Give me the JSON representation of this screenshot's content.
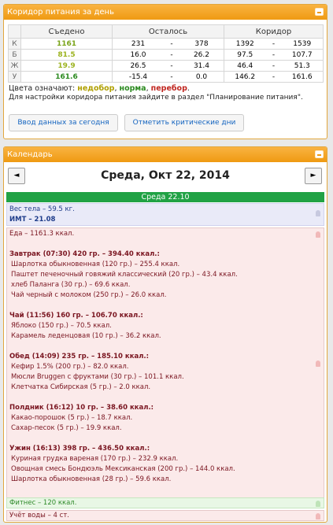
{
  "corridor_panel": {
    "title": "Коридор питания за день",
    "headers": [
      "Съедено",
      "Осталось",
      "Коридор"
    ],
    "rows": [
      {
        "label": "К",
        "eaten": "1161",
        "remain_min": "231",
        "remain_max": "378",
        "corr_min": "1392",
        "corr_max": "1539",
        "eaten_color": "#7aa41a"
      },
      {
        "label": "Б",
        "eaten": "81.5",
        "remain_min": "16.0",
        "remain_max": "26.2",
        "corr_min": "97.5",
        "corr_max": "107.7",
        "eaten_color": "#9cb31f"
      },
      {
        "label": "Ж",
        "eaten": "19.9",
        "remain_min": "26.5",
        "remain_max": "31.4",
        "corr_min": "46.4",
        "corr_max": "51.3",
        "eaten_color": "#9cb31f"
      },
      {
        "label": "У",
        "eaten": "161.6",
        "remain_min": "-15.4",
        "remain_max": "0.0",
        "corr_min": "146.2",
        "corr_max": "161.6",
        "eaten_color": "#2b8a1f"
      }
    ],
    "dash": "-",
    "legend": {
      "prefix": "Цвета означают:",
      "under": "недобор",
      "sep1": ",",
      "norm": "норма",
      "sep2": ",",
      "over": "перебор",
      "end": "."
    },
    "note": "Для настройки коридора питания зайдите в раздел \"Планирование питания\".",
    "btn_enter": "Ввод данных за сегодня",
    "btn_mark": "Отметить критические дни"
  },
  "calendar": {
    "title": "Календарь",
    "prev": "◄",
    "next": "►",
    "date_title": "Среда, Окт 22, 2014",
    "day_label": "Среда 22.10",
    "weight": "Вес тела – 59.5 кг.",
    "bmi": "ИМТ – 21.08",
    "food_total": "Еда – 1161.3 ккал.",
    "meals": [
      {
        "title": "Завтрак (07:30) 420 гр. – 394.40 ккал.:",
        "items": [
          "Шарлотка обыкновенная (120 гр.) – 255.4 ккал.",
          "Паштет печеночный говяжий классический (20 гр.) – 43.4 ккал.",
          "хлеб Паланга (30 гр.) – 69.6 ккал.",
          "Чай черный с молоком (250 гр.) – 26.0 ккал."
        ]
      },
      {
        "title": "Чай (11:56) 160 гр. – 106.70 ккал.:",
        "items": [
          "Яблоко (150 гр.) – 70.5 ккал.",
          "Карамель леденцовая (10 гр.) – 36.2 ккал."
        ]
      },
      {
        "title": "Обед (14:09) 235 гр. – 185.10 ккал.:",
        "items": [
          "Кефир 1.5% (200 гр.) – 82.0 ккал.",
          "Мюсли Bruggen с фруктами (30 гр.) – 101.1 ккал.",
          "Клетчатка Сибирская (5 гр.) – 2.0 ккал."
        ]
      },
      {
        "title": "Полдник (16:12) 10 гр. – 38.60 ккал.:",
        "items": [
          "Какао-порошок (5 гр.) – 18.7 ккал.",
          "Сахар-песок (5 гр.) – 19.9 ккал."
        ]
      },
      {
        "title": "Ужин (16:13) 398 гр. – 436.50 ккал.:",
        "items": [
          "Куриная грудка вареная (170 гр.) – 232.9 ккал.",
          "Овощная смесь Бондюэль Мексиканская (200 гр.) – 144.0 ккал.",
          "Шарлотка обыкновенная (28 гр.) – 59.6 ккал."
        ]
      }
    ],
    "fitness": "Фитнес – 120 ккал.",
    "water": "Учёт воды – 4 ст."
  }
}
